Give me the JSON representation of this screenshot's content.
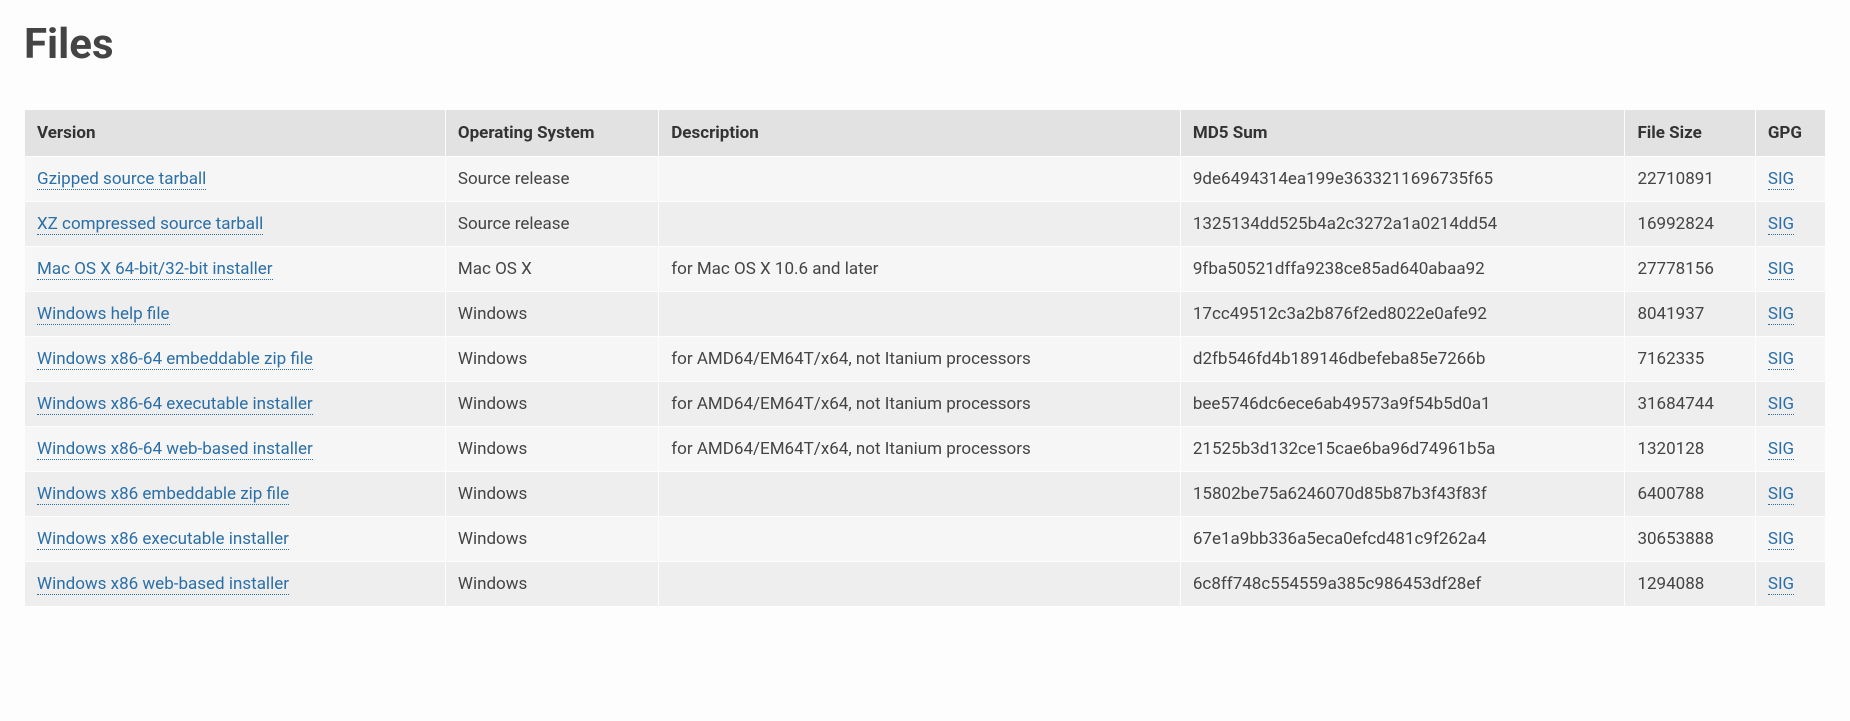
{
  "heading": "Files",
  "table": {
    "headers": {
      "version": "Version",
      "os": "Operating System",
      "description": "Description",
      "md5": "MD5 Sum",
      "size": "File Size",
      "gpg": "GPG"
    },
    "sig_label": "SIG",
    "rows": [
      {
        "version": "Gzipped source tarball",
        "os": "Source release",
        "description": "",
        "md5": "9de6494314ea199e3633211696735f65",
        "size": "22710891"
      },
      {
        "version": "XZ compressed source tarball",
        "os": "Source release",
        "description": "",
        "md5": "1325134dd525b4a2c3272a1a0214dd54",
        "size": "16992824"
      },
      {
        "version": "Mac OS X 64-bit/32-bit installer",
        "os": "Mac OS X",
        "description": "for Mac OS X 10.6 and later",
        "md5": "9fba50521dffa9238ce85ad640abaa92",
        "size": "27778156"
      },
      {
        "version": "Windows help file",
        "os": "Windows",
        "description": "",
        "md5": "17cc49512c3a2b876f2ed8022e0afe92",
        "size": "8041937"
      },
      {
        "version": "Windows x86-64 embeddable zip file",
        "os": "Windows",
        "description": "for AMD64/EM64T/x64, not Itanium processors",
        "md5": "d2fb546fd4b189146dbefeba85e7266b",
        "size": "7162335"
      },
      {
        "version": "Windows x86-64 executable installer",
        "os": "Windows",
        "description": "for AMD64/EM64T/x64, not Itanium processors",
        "md5": "bee5746dc6ece6ab49573a9f54b5d0a1",
        "size": "31684744"
      },
      {
        "version": "Windows x86-64 web-based installer",
        "os": "Windows",
        "description": "for AMD64/EM64T/x64, not Itanium processors",
        "md5": "21525b3d132ce15cae6ba96d74961b5a",
        "size": "1320128"
      },
      {
        "version": "Windows x86 embeddable zip file",
        "os": "Windows",
        "description": "",
        "md5": "15802be75a6246070d85b87b3f43f83f",
        "size": "6400788"
      },
      {
        "version": "Windows x86 executable installer",
        "os": "Windows",
        "description": "",
        "md5": "67e1a9bb336a5eca0efcd481c9f262a4",
        "size": "30653888"
      },
      {
        "version": "Windows x86 web-based installer",
        "os": "Windows",
        "description": "",
        "md5": "6c8ff748c554559a385c986453df28ef",
        "size": "1294088"
      }
    ]
  }
}
